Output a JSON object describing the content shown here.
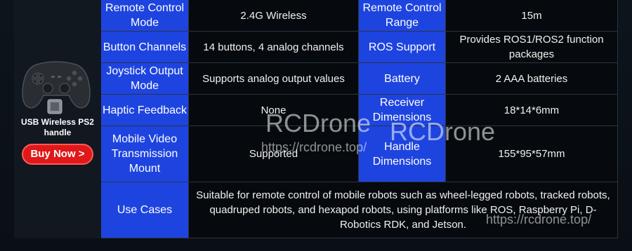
{
  "sidebar": {
    "product_label": "USB Wireless PS2 handle",
    "buy_button": "Buy Now >"
  },
  "specs": {
    "remote_control_mode_label": "Remote Control Mode",
    "remote_control_mode_value": "2.4G Wireless",
    "remote_control_range_label": "Remote Control Range",
    "remote_control_range_value": "15m",
    "button_channels_label": "Button Channels",
    "button_channels_value": "14 buttons, 4 analog channels",
    "ros_support_label": "ROS Support",
    "ros_support_value": "Provides ROS1/ROS2 function packages",
    "joystick_output_label": "Joystick Output Mode",
    "joystick_output_value": "Supports analog output values",
    "battery_label": "Battery",
    "battery_value": "2 AAA batteries",
    "haptic_label": "Haptic Feedback",
    "haptic_value": "None",
    "receiver_dim_label": "Receiver Dimensions",
    "receiver_dim_value": "18*14*6mm",
    "mobile_video_label": "Mobile Video Transmission Mount",
    "mobile_video_value": "Supported",
    "handle_dim_label": "Handle Dimensions",
    "handle_dim_value": "155*95*57mm",
    "use_cases_label": "Use Cases",
    "use_cases_value": "Suitable for remote control of mobile robots such as wheel-legged robots, tracked robots, quadruped robots, and hexapod robots, using platforms like ROS, Raspberry Pi, D-Robotics RDK, and Jetson."
  },
  "watermarks": {
    "brand_1": "RCDrone",
    "brand_2": "RCDrone",
    "url_1": "https://rcdrone.top/",
    "url_2": "https://rcdrone.top/"
  },
  "colors": {
    "label_bg": "#1e44e0",
    "value_bg": "#060a0e",
    "buy_button_bg": "#e01818"
  },
  "icons": {
    "controller": "gamepad-icon",
    "receiver": "usb-receiver-icon"
  }
}
